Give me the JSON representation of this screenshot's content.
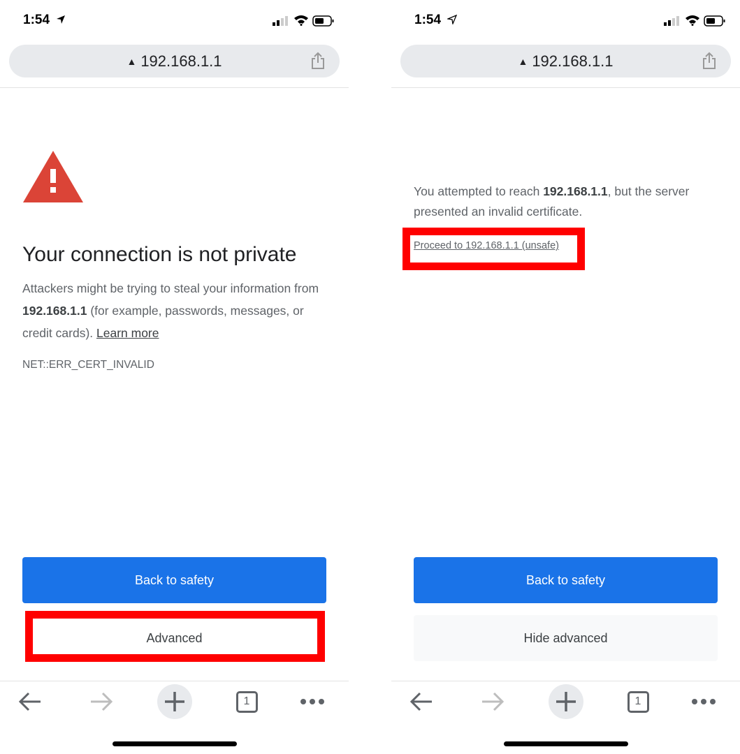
{
  "screens": [
    {
      "status": {
        "time": "1:54"
      },
      "url": "192.168.1.1",
      "heading": "Your connection is not private",
      "body": {
        "part1": "Attackers might be trying to steal your information from ",
        "host": "192.168.1.1",
        "part2": " (for example, passwords, messages, or credit cards). ",
        "learn_more": "Learn more"
      },
      "error_code": "NET::ERR_CERT_INVALID",
      "primary_button": "Back to safety",
      "secondary_button": "Advanced",
      "tab_count": "1"
    },
    {
      "status": {
        "time": "1:54"
      },
      "url": "192.168.1.1",
      "details": {
        "part1": "You attempted to reach ",
        "host": "192.168.1.1",
        "part2": ", but the server presented an invalid certificate."
      },
      "proceed_link": "Proceed to 192.168.1.1 (unsafe)",
      "primary_button": "Back to safety",
      "secondary_button": "Hide advanced",
      "tab_count": "1"
    }
  ],
  "colors": {
    "primary": "#1a73e8",
    "highlight": "#ff0000",
    "warning": "#db4437"
  }
}
